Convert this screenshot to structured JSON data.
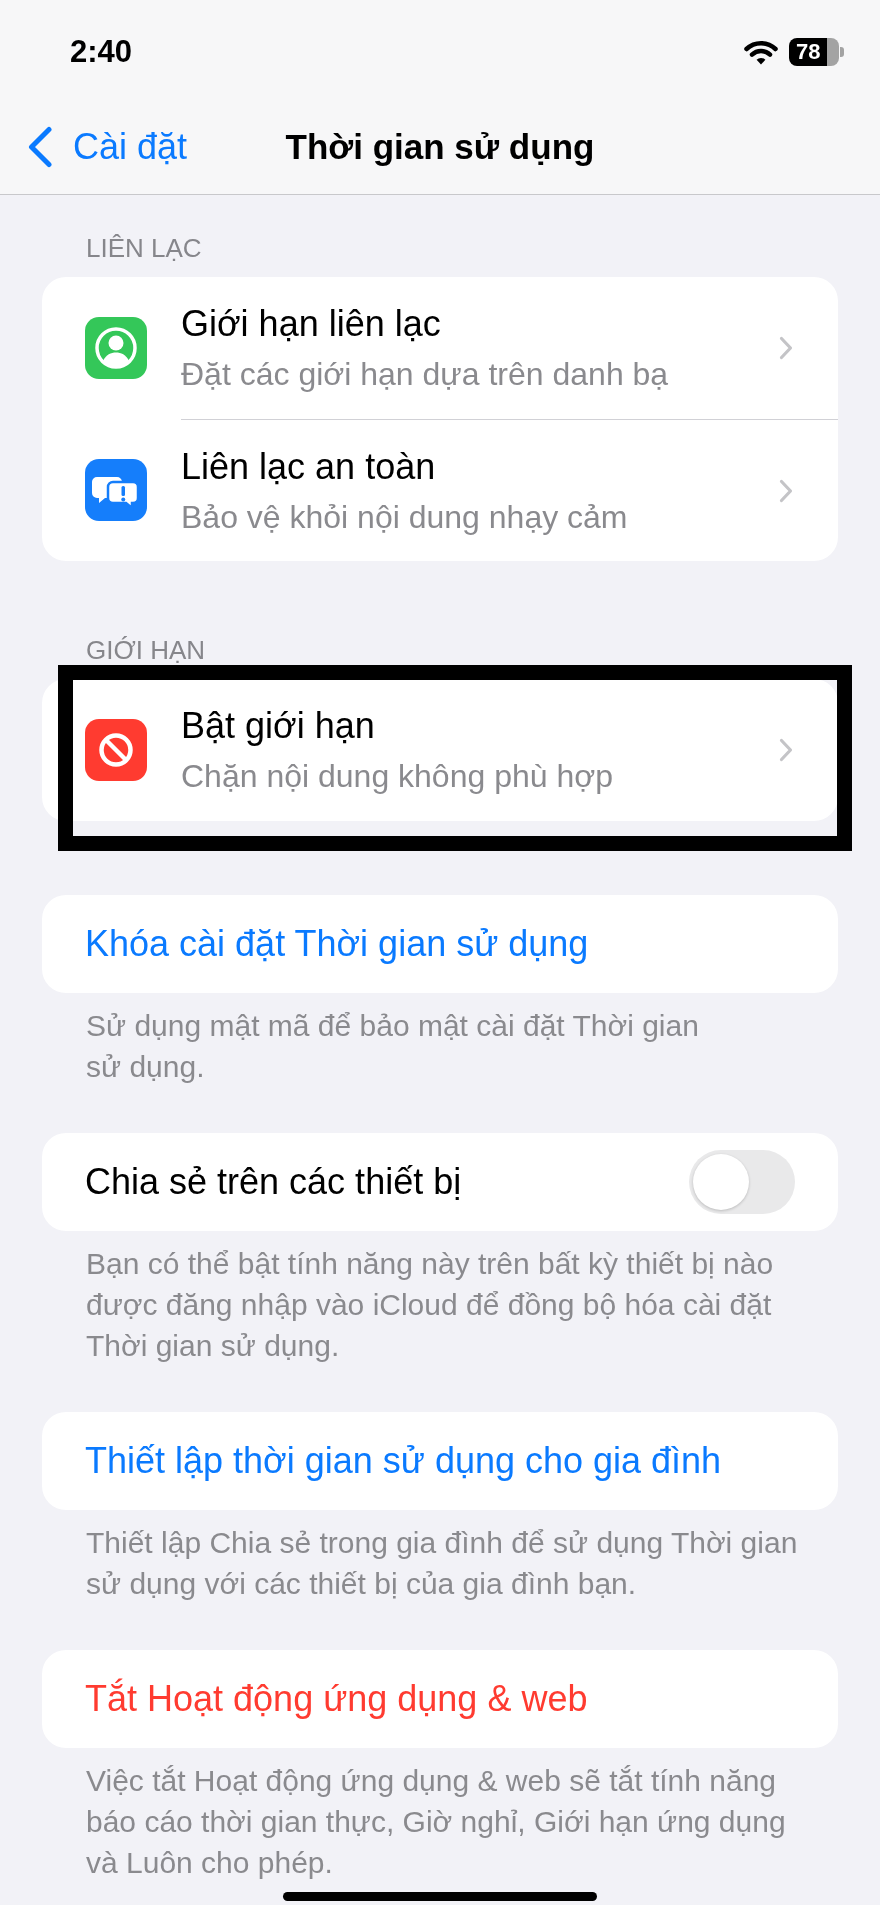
{
  "status_bar": {
    "time": "2:40",
    "battery": "78"
  },
  "nav_bar": {
    "back": "Cài đặt",
    "title": "Thời gian sử dụng"
  },
  "sections": [
    {
      "header": "LIÊN LẠC",
      "highlighted": false,
      "rows": [
        {
          "kind": "person",
          "color": "#34c759",
          "title": "Giới hạn liên lạc",
          "subtitle": "Đặt các giới hạn dựa trên danh bạ"
        },
        {
          "kind": "bubbles",
          "color": "#157efb",
          "title": "Liên lạc an toàn",
          "subtitle": "Bảo vệ khỏi nội dung nhạy cảm"
        }
      ]
    },
    {
      "header": "GIỚI HẠN",
      "highlighted": true,
      "rows": [
        {
          "kind": "block",
          "color": "#ff3b30",
          "title": "Bật giới hạn",
          "subtitle": "Chặn nội dung không phù hợp"
        }
      ]
    },
    {
      "highlighted": false,
      "rows": [
        {
          "kind": "link",
          "title": "Khóa cài đặt Thời gian sử dụng"
        }
      ],
      "footer": "Sử dụng mật mã để bảo mật cài đặt Thời gian sử dụng."
    },
    {
      "highlighted": false,
      "rows": [
        {
          "kind": "toggle",
          "title": "Chia sẻ trên các thiết bị",
          "on": false
        }
      ],
      "footer": "Bạn có thể bật tính năng này trên bất kỳ thiết bị nào được đăng nhập vào iCloud để đồng bộ hóa cài đặt Thời gian sử dụng."
    },
    {
      "highlighted": false,
      "rows": [
        {
          "kind": "link",
          "title": "Thiết lập thời gian sử dụng cho gia đình"
        }
      ],
      "footer": "Thiết lập Chia sẻ trong gia đình để sử dụng Thời gian sử dụng với các thiết bị của gia đình bạn."
    },
    {
      "highlighted": false,
      "rows": [
        {
          "kind": "destructive",
          "title": "Tắt Hoạt động ứng dụng & web"
        }
      ],
      "footer": "Việc tắt Hoạt động ứng dụng & web sẽ tắt tính năng báo cáo thời gian thực, Giờ nghỉ, Giới hạn ứng dụng và Luôn cho phép."
    }
  ]
}
